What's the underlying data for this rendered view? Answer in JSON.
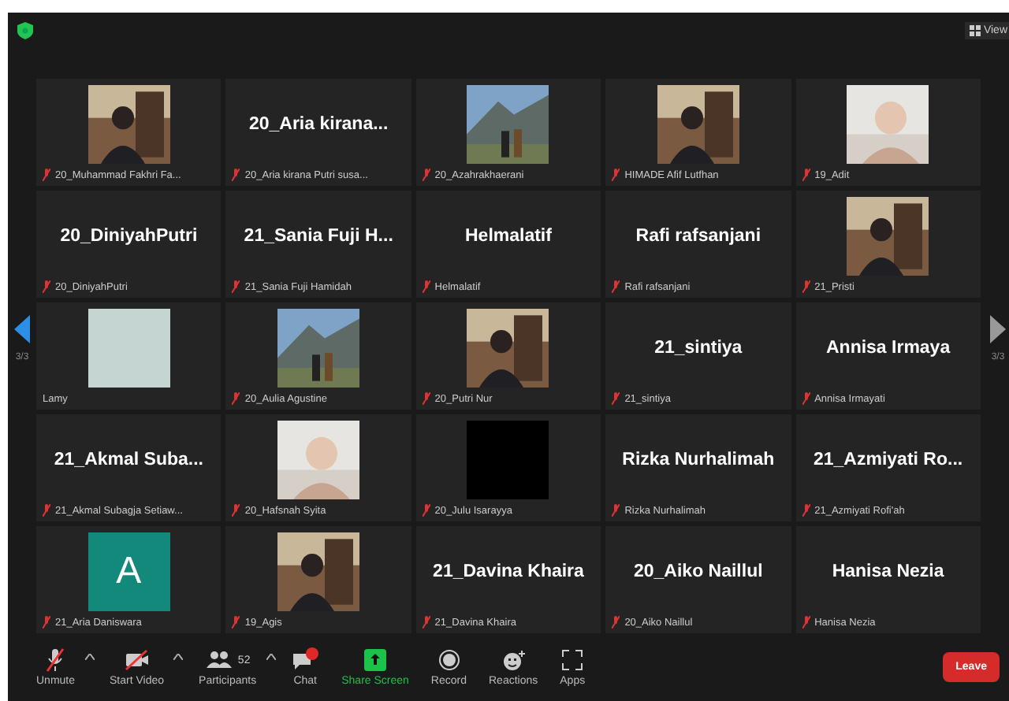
{
  "top_bar": {
    "view_label": "View"
  },
  "tiles": [
    {
      "kind": "picture",
      "label": "20_Muhammad Fakhri Fa...",
      "muted": true
    },
    {
      "kind": "name",
      "name": "20_Aria  kirana...",
      "label": "20_Aria kirana Putri susa...",
      "muted": true
    },
    {
      "kind": "picture",
      "label": "20_Azahrakhaerani",
      "muted": true
    },
    {
      "kind": "picture",
      "label": "HIMADE Afif Lutfhan",
      "muted": true
    },
    {
      "kind": "picture",
      "label": "19_Adit",
      "muted": true
    },
    {
      "kind": "name",
      "name": "20_DiniyahPutri",
      "label": "20_DiniyahPutri",
      "muted": true
    },
    {
      "kind": "name",
      "name": "21_Sania Fuji H...",
      "label": "21_Sania Fuji Hamidah",
      "muted": true
    },
    {
      "kind": "name",
      "name": "Helmalatif",
      "label": "Helmalatif",
      "muted": true
    },
    {
      "kind": "name",
      "name": "Rafi rafsanjani",
      "label": "Rafi rafsanjani",
      "muted": true
    },
    {
      "kind": "picture",
      "label": "21_Pristi",
      "muted": true
    },
    {
      "kind": "plain",
      "label": "Lamy",
      "muted": false
    },
    {
      "kind": "picture",
      "label": "20_Aulia Agustine",
      "muted": true
    },
    {
      "kind": "picture",
      "label": "20_Putri Nur",
      "muted": true
    },
    {
      "kind": "name",
      "name": "21_sintiya",
      "label": "21_sintiya",
      "muted": true
    },
    {
      "kind": "name",
      "name": "Annisa Irmaya",
      "label": "Annisa Irmayati",
      "muted": true
    },
    {
      "kind": "name",
      "name": "21_Akmal  Suba...",
      "label": "21_Akmal Subagja Setiaw...",
      "muted": true
    },
    {
      "kind": "picture",
      "label": "20_Hafsnah Syita",
      "muted": true
    },
    {
      "kind": "dark",
      "label": "20_Julu Isarayya",
      "muted": true
    },
    {
      "kind": "name",
      "name": "Rizka Nurhalimah",
      "label": "Rizka Nurhalimah",
      "muted": true
    },
    {
      "kind": "name",
      "name": "21_Azmiyati  Ro...",
      "label": "21_Azmiyati Rofi'ah",
      "muted": true
    },
    {
      "kind": "avatar",
      "letter": "A",
      "label": "21_Aria Daniswara",
      "muted": true
    },
    {
      "kind": "picture",
      "label": "19_Agis",
      "muted": true
    },
    {
      "kind": "name",
      "name": "21_Davina Khaira",
      "label": "21_Davina Khaira",
      "muted": true
    },
    {
      "kind": "name",
      "name": "20_Aiko Naillul",
      "label": "20_Aiko Naillul",
      "muted": true
    },
    {
      "kind": "name",
      "name": "Hanisa Nezia",
      "label": "Hanisa Nezia",
      "muted": true
    }
  ],
  "pager": {
    "prev_label": "3/3",
    "next_label": "3/3"
  },
  "toolbar": {
    "items": [
      {
        "kind": "mic",
        "label": "Unmute",
        "caret": true
      },
      {
        "kind": "video",
        "label": "Start Video",
        "caret": true
      },
      {
        "kind": "participants",
        "label": "Participants",
        "count": "52",
        "caret": true
      },
      {
        "kind": "chat",
        "label": "Chat",
        "caret": false
      },
      {
        "kind": "share",
        "label": "Share Screen",
        "caret": false
      },
      {
        "kind": "record",
        "label": "Record",
        "caret": false
      },
      {
        "kind": "reactions",
        "label": "Reactions",
        "caret": false
      },
      {
        "kind": "apps",
        "label": "Apps",
        "caret": false
      }
    ],
    "leave": "Leave"
  }
}
